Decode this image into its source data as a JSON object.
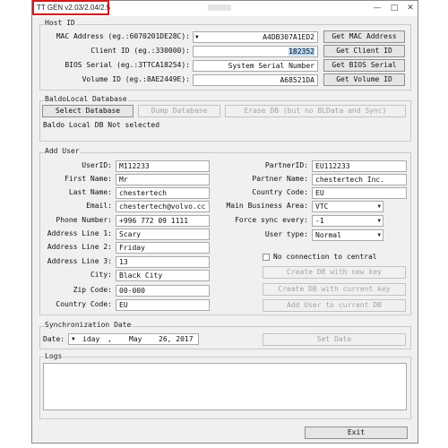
{
  "window": {
    "title": "TT GEN v2.03/2.04/2.5",
    "controls": {
      "minimize": "—",
      "maximize": "□",
      "close": "✕"
    }
  },
  "host": {
    "section": "Host ID",
    "mac_label": "MAC Address (eg.:6070201DE28C):",
    "mac_value": "A4DB307A1ED2",
    "mac_button": "Get MAC Address",
    "client_label": "Client ID (eg.:330000):",
    "client_value": "182352",
    "client_button": "Get Client ID",
    "bios_label": "BIOS Serial (eg.:3TTCA18254):",
    "bios_value": "System Serial Number",
    "bios_button": "Get BIOS Serial",
    "volume_label": "Volume ID (eg.:8AE2449E):",
    "volume_value": "A68521DA",
    "volume_button": "Get Volume ID"
  },
  "db": {
    "section": "BaldoLocal Database",
    "select_button": "Select Database",
    "dump_button": "Dump Database",
    "erase_button": "Erase DB (but no BLData and Sync)",
    "status": "Baldo Local DB Not selected"
  },
  "user": {
    "section": "Add User",
    "userid_label": "UserID:",
    "userid_value": "M112233",
    "firstname_label": "First Name:",
    "firstname_value": "Mr",
    "lastname_label": "Last Name:",
    "lastname_value": "chestertech",
    "email_label": "Email:",
    "email_value": "chestertech@volvo.cc",
    "phone_label": "Phone Number:",
    "phone_value": "+996 772 09 1111",
    "addr1_label": "Address Line 1:",
    "addr1_value": "Scary",
    "addr2_label": "Address Line 2:",
    "addr2_value": "Friday",
    "addr3_label": "Address Line 3:",
    "addr3_value": "13",
    "city_label": "City:",
    "city_value": "Black City",
    "zip_label": "Zip Code:",
    "zip_value": "00-000",
    "country_label": "Country Code:",
    "country_value": "EU",
    "partnerid_label": "PartnerID:",
    "partnerid_value": "EU112233",
    "partnername_label": "Partner Name:",
    "partnername_value": "chestertech Inc.",
    "pcountry_label": "Country Code:",
    "pcountry_value": "EU",
    "business_label": "Main Business Area:",
    "business_value": "VTC",
    "forcesync_label": "Force sync every:",
    "forcesync_value": "-1",
    "usertype_label": "User type:",
    "usertype_value": "Normal",
    "noconn_label": "No connection to central",
    "create_new_button": "Create DB with new key",
    "create_current_button": "Create DB with current key",
    "add_user_button": "Add User to current DB"
  },
  "sync": {
    "section": "Synchronization Date",
    "date_label": "Date:",
    "date_day": "iday",
    "date_sep": ",",
    "date_month": "May",
    "date_rest": "26, 2017",
    "set_date_button": "Set Date"
  },
  "logs": {
    "section": "Logs"
  },
  "footer": {
    "exit_button": "Exit"
  }
}
